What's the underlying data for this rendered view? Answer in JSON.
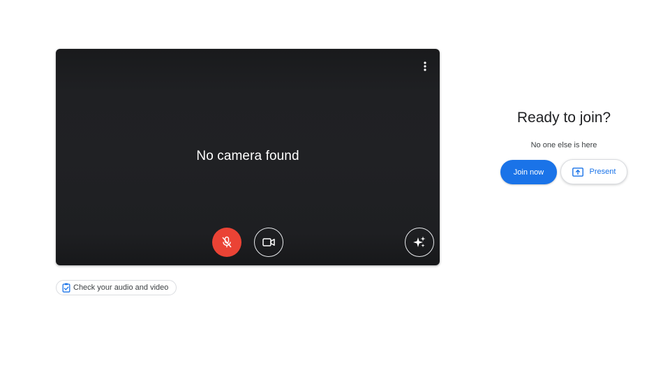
{
  "preview": {
    "message": "No camera found",
    "more_options_icon": "more-vert-icon",
    "mic_button": {
      "icon": "mic-off-icon",
      "state": "muted",
      "color": "#ea4335"
    },
    "camera_button": {
      "icon": "videocam-icon"
    },
    "effects_button": {
      "icon": "sparkle-icon"
    }
  },
  "check_audio": {
    "label": "Check your audio and video",
    "icon": "clipboard-check-icon"
  },
  "join_panel": {
    "title": "Ready to join?",
    "status": "No one else is here",
    "join_label": "Join now",
    "present_label": "Present",
    "present_icon": "present-to-all-icon",
    "accent": "#1a73e8"
  }
}
